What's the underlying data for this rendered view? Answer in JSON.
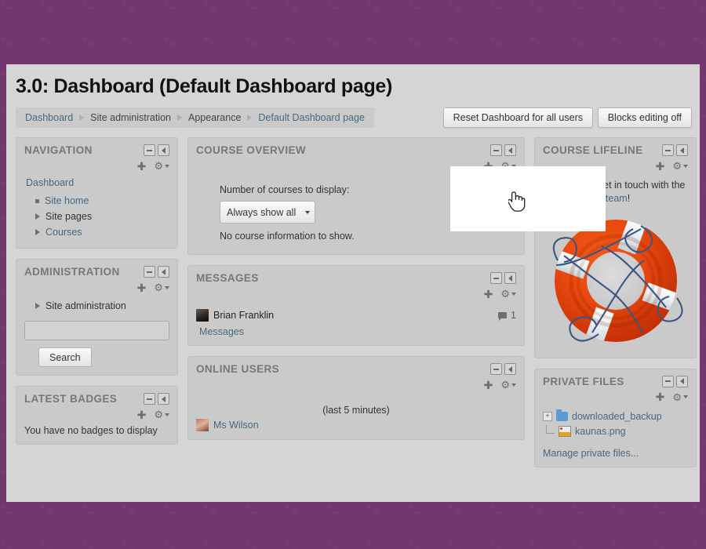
{
  "page": {
    "title": "3.0: Dashboard (Default Dashboard page)"
  },
  "breadcrumb": {
    "items": [
      {
        "label": "Dashboard",
        "link": true
      },
      {
        "label": "Site administration",
        "link": false
      },
      {
        "label": "Appearance",
        "link": false
      },
      {
        "label": "Default Dashboard page",
        "link": true
      }
    ]
  },
  "toolbar": {
    "reset_label": "Reset Dashboard for all users",
    "blocks_editing_label": "Blocks editing off"
  },
  "colors": {
    "page_background": "#74376d",
    "content_background": "#d5d5d5",
    "block_background": "#cacaca",
    "link": "#47687e",
    "heading": "#777777"
  },
  "blocks": {
    "navigation": {
      "title": "NAVIGATION",
      "root": "Dashboard",
      "items": [
        {
          "label": "Site home",
          "marker": "square"
        },
        {
          "label": "Site pages",
          "marker": "triangle"
        },
        {
          "label": "Courses",
          "marker": "triangle"
        }
      ]
    },
    "administration": {
      "title": "ADMINISTRATION",
      "item": "Site administration",
      "search_value": "",
      "search_placeholder": "",
      "search_button": "Search"
    },
    "latest_badges": {
      "title": "LATEST BADGES",
      "empty_text": "You have no badges to display"
    },
    "course_overview": {
      "title": "COURSE OVERVIEW",
      "label": "Number of courses to display:",
      "select_value": "Always show all",
      "note": "No course information to show."
    },
    "messages": {
      "title": "MESSAGES",
      "user": "Brian Franklin",
      "count": "1",
      "link": "Messages"
    },
    "online_users": {
      "title": "ONLINE USERS",
      "subtitle": "(last 5 minutes)",
      "user": "Ms Wilson"
    },
    "course_lifeline": {
      "title": "COURSE LIFELINE",
      "text_before": "Need help? Get in touch with the ",
      "link_text": "course lifeline team",
      "text_after": "!"
    },
    "private_files": {
      "title": "PRIVATE FILES",
      "folder": "downloaded_backup",
      "file": "kaunas.png",
      "manage_link": "Manage private files..."
    }
  },
  "icons": {
    "collapse": "minus-icon",
    "dock": "dock-left-arrow-icon",
    "move": "move-cross-icon",
    "gear": "gear-icon",
    "caret": "chevron-down-icon",
    "cursor": "hand-pointer-cursor",
    "lifebuoy": "lifebuoy-image"
  }
}
